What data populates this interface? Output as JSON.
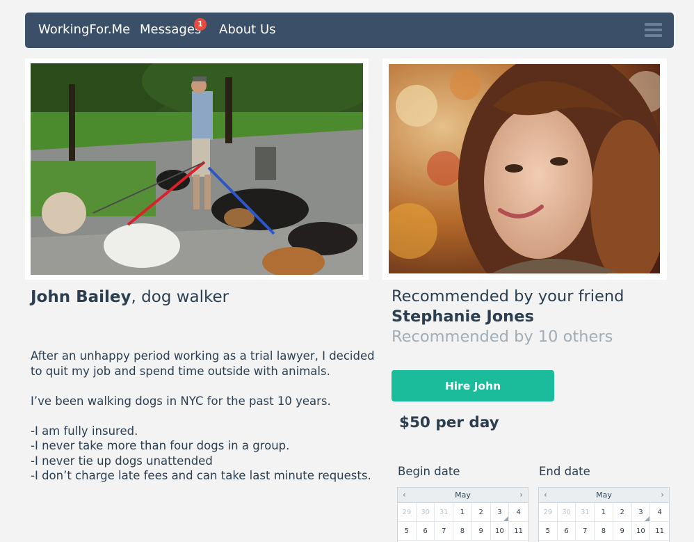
{
  "nav": {
    "brand": "WorkingFor.Me",
    "messages_label": "Messages",
    "messages_badge": "1",
    "about_label": "About Us",
    "menu_icon": "hamburger-menu-icon"
  },
  "profile": {
    "name": "John Bailey",
    "role_suffix": ", dog walker",
    "photo": "dog-walker-with-dogs-photo",
    "bio": [
      "After an unhappy period working as a trial lawyer, I decided",
      "to quit my job and spend time outside with animals.",
      "",
      "I’ve been walking dogs in NYC for the past 10 years.",
      "",
      "-I am fully  insured.",
      "-I never take more than four dogs in a group.",
      "-I never tie up dogs unattended",
      "-I don’t charge late fees and can take last minute requests."
    ]
  },
  "recommendation": {
    "photo": "recommender-portrait-photo",
    "line1": "Recommended by your friend",
    "friend_name": "Stephanie Jones",
    "others": "Recommended by 10 others"
  },
  "hire": {
    "button_label": "Hire John",
    "price": "$50 per day"
  },
  "begin_date": {
    "label": "Begin date",
    "calendar": {
      "month": "May",
      "rows": [
        [
          "29",
          "30",
          "31",
          "1",
          "2",
          "3",
          "4"
        ],
        [
          "5",
          "6",
          "7",
          "8",
          "9",
          "10",
          "11"
        ]
      ]
    }
  },
  "end_date": {
    "label": "End date",
    "calendar": {
      "month": "May",
      "rows": [
        [
          "29",
          "30",
          "31",
          "1",
          "2",
          "3",
          "4"
        ],
        [
          "5",
          "6",
          "7",
          "8",
          "9",
          "10",
          "11"
        ]
      ]
    }
  },
  "colors": {
    "navbar": "#3c4f69",
    "accent": "#1abc9c",
    "badge": "#e74c3c",
    "text": "#2c3e50",
    "muted_text": "#a3adb6"
  }
}
